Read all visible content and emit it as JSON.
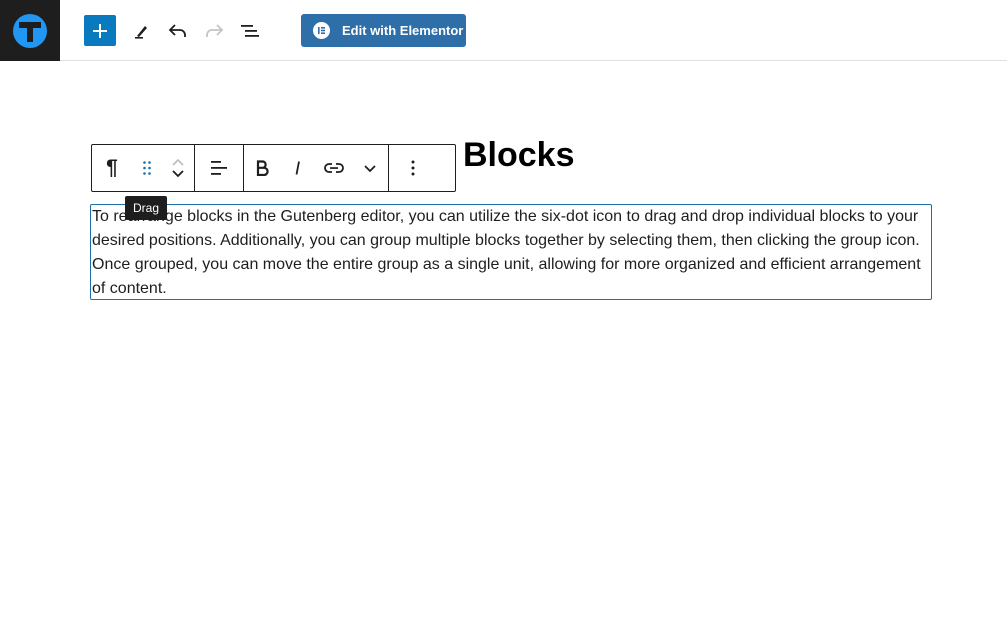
{
  "topbar": {
    "add_block_label": "Add block",
    "tools_label": "Tools",
    "undo_label": "Undo",
    "redo_label": "Redo",
    "list_view_label": "Document Overview",
    "elementor_button": "Edit with Elementor"
  },
  "content": {
    "heading_visible": "Blocks",
    "paragraph": "To rearrange blocks in the Gutenberg editor, you can utilize the six-dot icon to drag and drop individual blocks to your desired positions. Additionally, you can group multiple blocks together by selecting them, then clicking the group icon. Once grouped, you can move the entire group as a single unit, allowing for more organized and efficient arrangement of content."
  },
  "block_toolbar": {
    "paragraph_icon": "¶",
    "tooltip": "Drag"
  },
  "colors": {
    "accent": "#0a7abf",
    "elementor": "#2f6fa9",
    "selection_border": "#1d6fa5",
    "logo_bg": "#1e1e1e"
  }
}
